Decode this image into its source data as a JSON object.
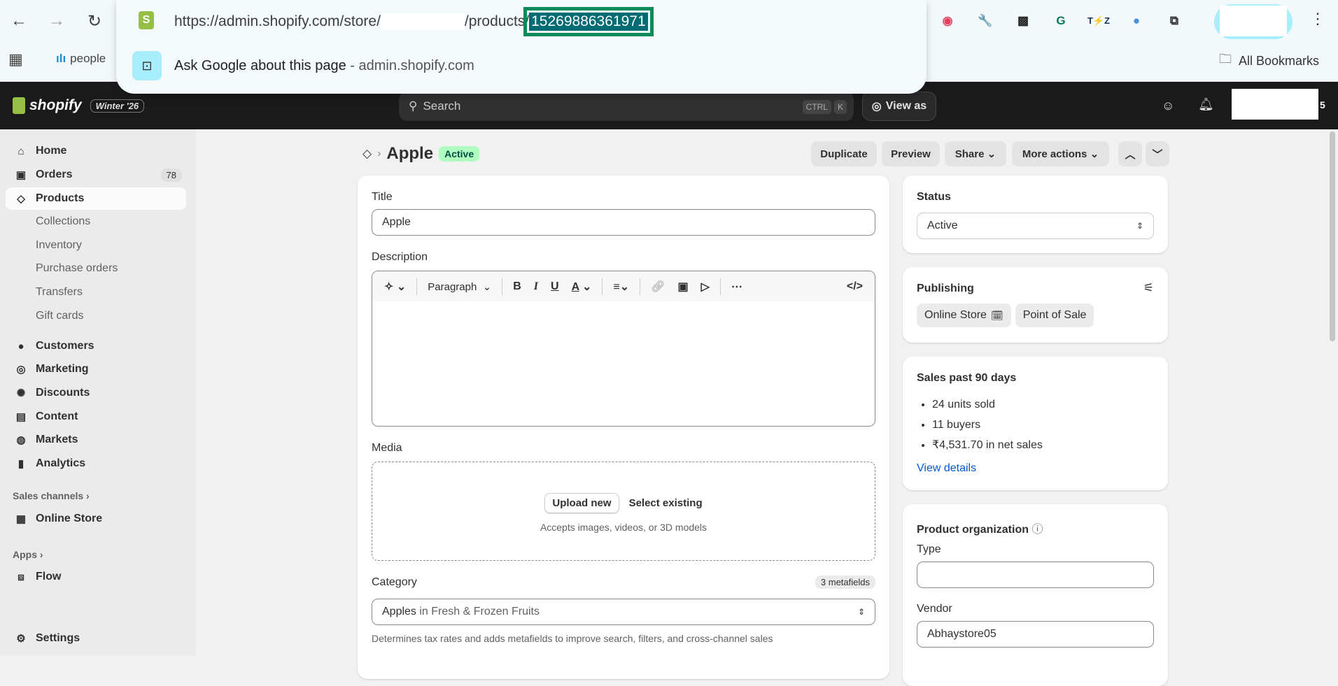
{
  "browser": {
    "url_prefix": "https://admin.shopify.com/store/",
    "url_mid": "/products/",
    "url_id": "15269886361971",
    "suggestion": "Ask Google about this page",
    "suggestion_domain": "admin.shopify.com",
    "bookmark_people": "people",
    "all_bookmarks": "All Bookmarks"
  },
  "topbar": {
    "logo": "shopify",
    "edition": "Winter '26",
    "search_placeholder": "Search",
    "kbd1": "CTRL",
    "kbd2": "K",
    "view_as": "View as",
    "store_suffix": "5"
  },
  "sidebar": {
    "items": [
      {
        "label": "Home",
        "icon": "⌂"
      },
      {
        "label": "Orders",
        "icon": "▣",
        "badge": "78"
      },
      {
        "label": "Products",
        "icon": "◇"
      },
      {
        "label": "Collections"
      },
      {
        "label": "Inventory"
      },
      {
        "label": "Purchase orders"
      },
      {
        "label": "Transfers"
      },
      {
        "label": "Gift cards"
      },
      {
        "label": "Customers",
        "icon": "●"
      },
      {
        "label": "Marketing",
        "icon": "◎"
      },
      {
        "label": "Discounts",
        "icon": "✺"
      },
      {
        "label": "Content",
        "icon": "▤"
      },
      {
        "label": "Markets",
        "icon": "◍"
      },
      {
        "label": "Analytics",
        "icon": "▮"
      }
    ],
    "sales_channels": "Sales channels",
    "online_store": "Online Store",
    "apps": "Apps",
    "flow": "Flow",
    "settings": "Settings"
  },
  "header": {
    "title": "Apple",
    "status": "Active",
    "duplicate": "Duplicate",
    "preview": "Preview",
    "share": "Share",
    "more": "More actions"
  },
  "product": {
    "title_label": "Title",
    "title_value": "Apple",
    "description_label": "Description",
    "paragraph": "Paragraph",
    "media_label": "Media",
    "upload": "Upload new",
    "select_existing": "Select existing",
    "media_hint": "Accepts images, videos, or 3D models",
    "category_label": "Category",
    "metafields": "3 metafields",
    "category_value": "Apples",
    "category_in": "in Fresh & Frozen Fruits",
    "category_help": "Determines tax rates and adds metafields to improve search, filters, and cross-channel sales"
  },
  "status_card": {
    "label": "Status",
    "value": "Active"
  },
  "publishing": {
    "label": "Publishing",
    "channels": [
      "Online Store",
      "Point of Sale"
    ]
  },
  "sales": {
    "label": "Sales past 90 days",
    "items": [
      "24 units sold",
      "11 buyers",
      "₹4,531.70 in net sales"
    ],
    "link": "View details"
  },
  "org": {
    "label": "Product organization",
    "type_label": "Type",
    "type_value": "",
    "vendor_label": "Vendor",
    "vendor_value": "Abhaystore05"
  }
}
